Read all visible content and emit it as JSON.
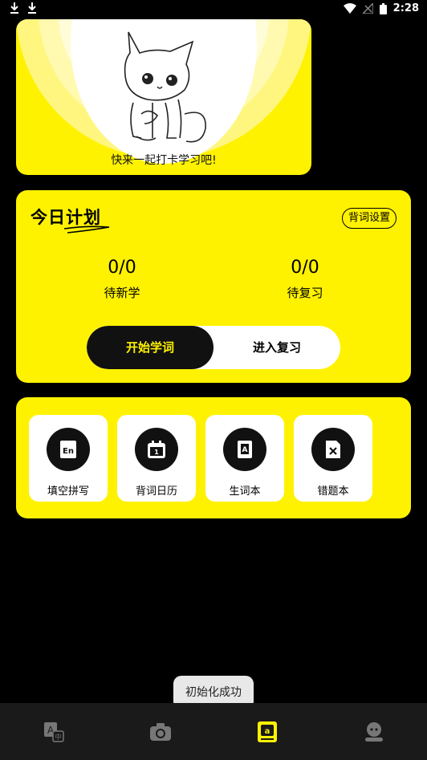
{
  "status_bar": {
    "time": "2:28"
  },
  "banner": {
    "caption": "快来一起打卡学习吧!"
  },
  "plan": {
    "title": "今日计划",
    "settings_label": "背词设置",
    "new_count": "0/0",
    "new_label": "待新学",
    "review_count": "0/0",
    "review_label": "待复习",
    "start_label": "开始学词",
    "review_btn_label": "进入复习"
  },
  "tools": [
    {
      "label": "填空拼写",
      "icon": "en-book-icon"
    },
    {
      "label": "背词日历",
      "icon": "calendar-icon"
    },
    {
      "label": "生词本",
      "icon": "vocab-book-icon"
    },
    {
      "label": "错题本",
      "icon": "mistake-book-icon"
    }
  ],
  "toast": "初始化成功",
  "colors": {
    "accent": "#fff200",
    "background": "#000000",
    "nav": "#1a1a1a"
  },
  "bottom_nav": [
    {
      "icon": "translate-icon",
      "active": false
    },
    {
      "icon": "camera-icon",
      "active": false
    },
    {
      "icon": "wordbook-icon",
      "active": true
    },
    {
      "icon": "profile-icon",
      "active": false
    }
  ]
}
